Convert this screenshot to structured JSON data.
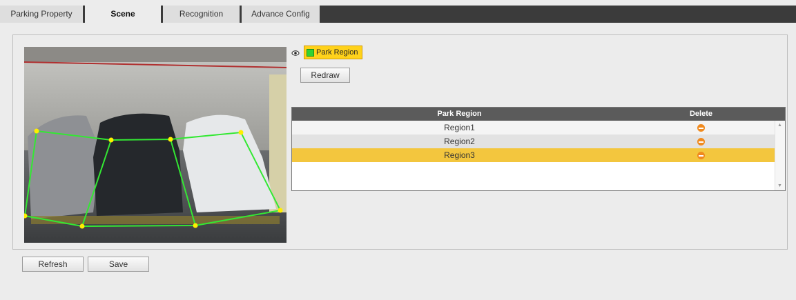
{
  "tabs": [
    {
      "label": "Parking Property",
      "active": false
    },
    {
      "label": "Scene",
      "active": true
    },
    {
      "label": "Recognition",
      "active": false
    },
    {
      "label": "Advance Config",
      "active": false
    }
  ],
  "legend": {
    "label": "Park Region",
    "swatch_color": "#32d232",
    "highlight_color": "#ffd21a"
  },
  "buttons": {
    "redraw": "Redraw",
    "refresh": "Refresh",
    "save": "Save"
  },
  "table": {
    "headers": {
      "name": "Park Region",
      "delete": "Delete"
    },
    "rows": [
      {
        "name": "Region1",
        "selected": false
      },
      {
        "name": "Region2",
        "selected": false
      },
      {
        "name": "Region3",
        "selected": true
      }
    ]
  },
  "colors": {
    "region_line": "#33e833",
    "vertex": "#ffee00",
    "selected_row": "#f3c63e"
  }
}
